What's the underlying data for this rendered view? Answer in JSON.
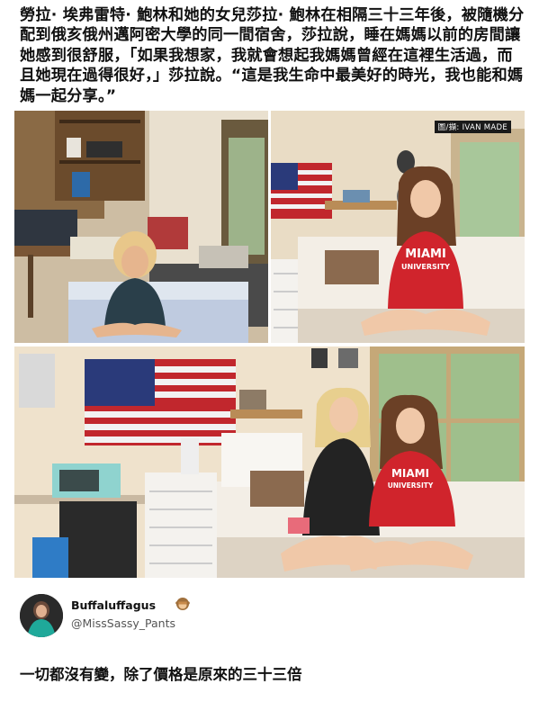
{
  "post": {
    "caption": "勞拉· 埃弗雷特· 鮑林和她的女兒莎拉· 鮑林在相隔三十三年後，被隨機分配到俄亥俄州邁阿密大學的同一間宿舍，莎拉說，睡在媽媽以前的房間讓她感到很舒服，「如果我想家，我就會想起我媽媽曾經在這裡生活過，而且她現在過得很好，」莎拉說。“這是我生命中最美好的時光，我也能和媽媽一起分享。”",
    "photo_credit": "圖/擷: IVAN MADE",
    "shirt_text_1": "MIAMI",
    "shirt_text_2": "UNIVERSITY"
  },
  "reply": {
    "display_name": "Buffaluffagus",
    "emoji_icon": "see-no-evil-monkey-icon",
    "handle": "@MissSassy_Pants",
    "text": "一切都沒有變，除了價格是原來的三十三倍"
  },
  "colors": {
    "shirt_red": "#d0242c",
    "flag_red": "#c1272d",
    "flag_blue": "#2a3a7a"
  }
}
